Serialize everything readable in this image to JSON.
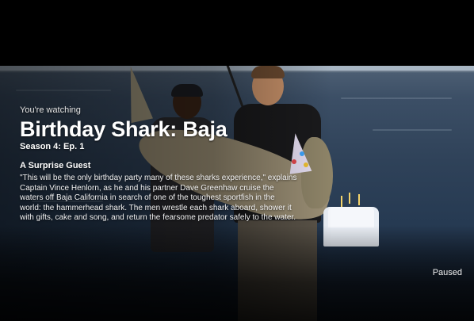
{
  "player": {
    "label_watching": "You're watching",
    "title": "Birthday Shark: Baja",
    "episode": "Season 4: Ep. 1",
    "episode_title": "A Surprise Guest",
    "synopsis": "\"This will be the only birthday party many of these sharks experience,\" explains Captain Vince Henlorn, as he and his partner Dave Greenhaw cruise the waters off Baja California in search of one of the toughest sportfish in the world: the hammerhead shark. The men wrestle each shark aboard, shower it with gifts, cake and song, and return the fearsome predator safely to the water.",
    "status": "Paused"
  }
}
